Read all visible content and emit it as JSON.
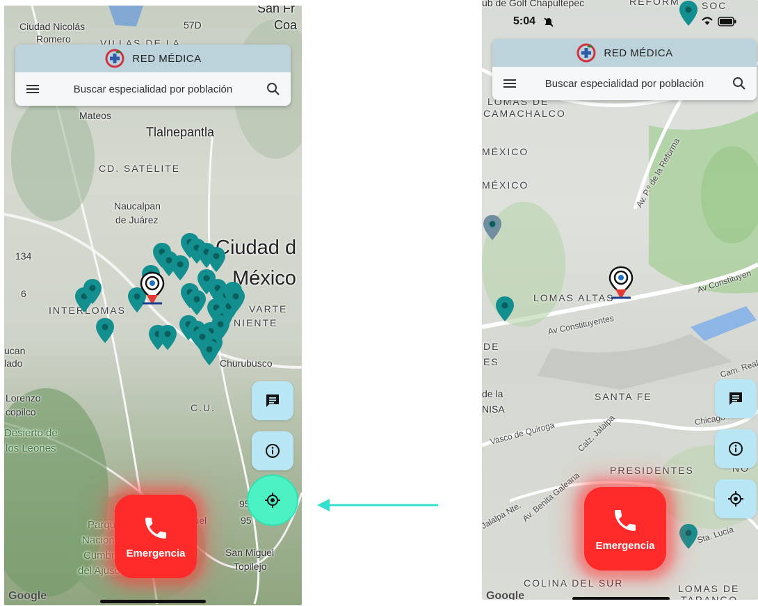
{
  "header": {
    "brand": "RED MÉDICA",
    "search_text": "Buscar especialidad por población"
  },
  "status_bar": {
    "time": "5:04"
  },
  "emergency": {
    "label": "Emergencia"
  },
  "attribution": "Google",
  "colors": {
    "header_band": "#bcd3dc",
    "fab_bg": "#b9e6f4",
    "fab_highlight": "#4cf2c4",
    "emergency": "#ff2b2b",
    "pin": "#138f8f",
    "arrow": "#33e0d0"
  },
  "icons": {
    "menu": "menu-icon",
    "search": "search-icon",
    "chat": "chat-icon",
    "info": "info-icon",
    "locate": "my-location-icon",
    "phone": "phone-icon",
    "user_location": "user-location-pin-icon",
    "clinic_pin": "clinic-pin-icon"
  },
  "left_map": {
    "labels": [
      {
        "text": "Ciudad Nicolás",
        "cls": ""
      },
      {
        "text": "Romero",
        "cls": ""
      },
      {
        "text": "San Fr",
        "cls": "city"
      },
      {
        "text": "Coa",
        "cls": "city"
      },
      {
        "text": "57D",
        "cls": ""
      },
      {
        "text": "VILLAS DE LA",
        "cls": "caps"
      },
      {
        "text": "Mateos",
        "cls": ""
      },
      {
        "text": "Tlalnepantla",
        "cls": "city"
      },
      {
        "text": "CD. SATÉLITE",
        "cls": "caps"
      },
      {
        "text": "Naucalpan",
        "cls": ""
      },
      {
        "text": "de Juárez",
        "cls": ""
      },
      {
        "text": "Ciudad d",
        "cls": "big"
      },
      {
        "text": "México",
        "cls": "big"
      },
      {
        "text": "134",
        "cls": ""
      },
      {
        "text": "6",
        "cls": ""
      },
      {
        "text": "INTERLOMAS",
        "cls": "caps"
      },
      {
        "text": "VARTE",
        "cls": "caps"
      },
      {
        "text": "NIENTE",
        "cls": "caps"
      },
      {
        "text": "ucan",
        "cls": ""
      },
      {
        "text": "lado",
        "cls": ""
      },
      {
        "text": "Churubusco",
        "cls": ""
      },
      {
        "text": "Lorenzo",
        "cls": ""
      },
      {
        "text": "copilco",
        "cls": ""
      },
      {
        "text": "C.U.",
        "cls": "caps"
      },
      {
        "text": "Desierto de",
        "cls": "green"
      },
      {
        "text": "los Leones",
        "cls": "green"
      },
      {
        "text": "Parque",
        "cls": "green"
      },
      {
        "text": "Nacional",
        "cls": "green"
      },
      {
        "text": "Cumbres",
        "cls": "green"
      },
      {
        "text": "del Ajusco",
        "cls": "green"
      },
      {
        "text": "Miguel",
        "cls": ""
      },
      {
        "text": "usco",
        "cls": ""
      },
      {
        "text": "95",
        "cls": ""
      },
      {
        "text": "95",
        "cls": ""
      },
      {
        "text": "San Miguel",
        "cls": ""
      },
      {
        "text": "Topilejo",
        "cls": ""
      }
    ]
  },
  "right_map": {
    "labels": [
      {
        "text": "ub de Golf Chapultepec",
        "cls": ""
      },
      {
        "text": "REFORM",
        "cls": "caps"
      },
      {
        "text": "SOC",
        "cls": "caps"
      },
      {
        "text": "LOMAS DE",
        "cls": "caps"
      },
      {
        "text": "CAMACHALCO",
        "cls": "caps"
      },
      {
        "text": "MÉXICO",
        "cls": "caps"
      },
      {
        "text": "MÉXICO",
        "cls": "caps"
      },
      {
        "text": "Av. P.º de la Reforma",
        "cls": "road"
      },
      {
        "text": "LOMAS ALTAS",
        "cls": "caps"
      },
      {
        "text": "Av Constituyentes",
        "cls": "road"
      },
      {
        "text": "Av Constituyen",
        "cls": "road"
      },
      {
        "text": "DE",
        "cls": "caps"
      },
      {
        "text": "ES",
        "cls": "caps"
      },
      {
        "text": "SANTA FE",
        "cls": "caps"
      },
      {
        "text": "Cam. Real",
        "cls": "road"
      },
      {
        "text": "de la",
        "cls": ""
      },
      {
        "text": "NISA",
        "cls": ""
      },
      {
        "text": "Vasco de Quiroga",
        "cls": "road"
      },
      {
        "text": "Calz. Jalalpa",
        "cls": "road"
      },
      {
        "text": "Chicago",
        "cls": "road"
      },
      {
        "text": "PRESIDENTES",
        "cls": "caps"
      },
      {
        "text": "Av. Benita Galeana",
        "cls": "road"
      },
      {
        "text": "Jalalpa Nte.",
        "cls": "road"
      },
      {
        "text": "Sta. Lucía",
        "cls": "road"
      },
      {
        "text": "COLINA DEL SUR",
        "cls": "caps"
      },
      {
        "text": "LOMAS DE",
        "cls": "caps"
      },
      {
        "text": "TARANGO",
        "cls": "caps"
      },
      {
        "text": "NO",
        "cls": "caps"
      }
    ]
  }
}
